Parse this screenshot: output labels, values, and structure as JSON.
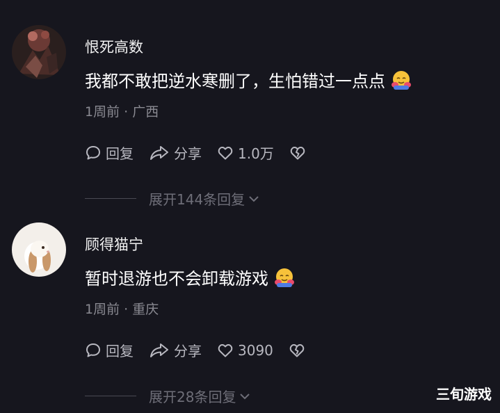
{
  "comments": [
    {
      "username": "恨死高数",
      "text": "我都不敢把逆水寒删了，生怕错过一点点",
      "time": "1周前",
      "location": "广西",
      "reply_label": "回复",
      "share_label": "分享",
      "likes": "1.0万",
      "expand_label": "展开144条回复"
    },
    {
      "username": "顾得猫宁",
      "text": "暂时退游也不会卸载游戏",
      "time": "1周前",
      "location": "重庆",
      "reply_label": "回复",
      "share_label": "分享",
      "likes": "3090",
      "expand_label": "展开28条回复"
    }
  ],
  "meta_separator": " · ",
  "watermark": "三旬游戏",
  "icons": [
    "reply-bubble-icon",
    "share-arrow-icon",
    "heart-icon",
    "broken-heart-icon",
    "chevron-down-icon",
    "hugging-face-emoji"
  ],
  "colors": {
    "background": "#16161e",
    "secondary_text": "#8a8a92",
    "action_text": "#b8b8c0"
  }
}
